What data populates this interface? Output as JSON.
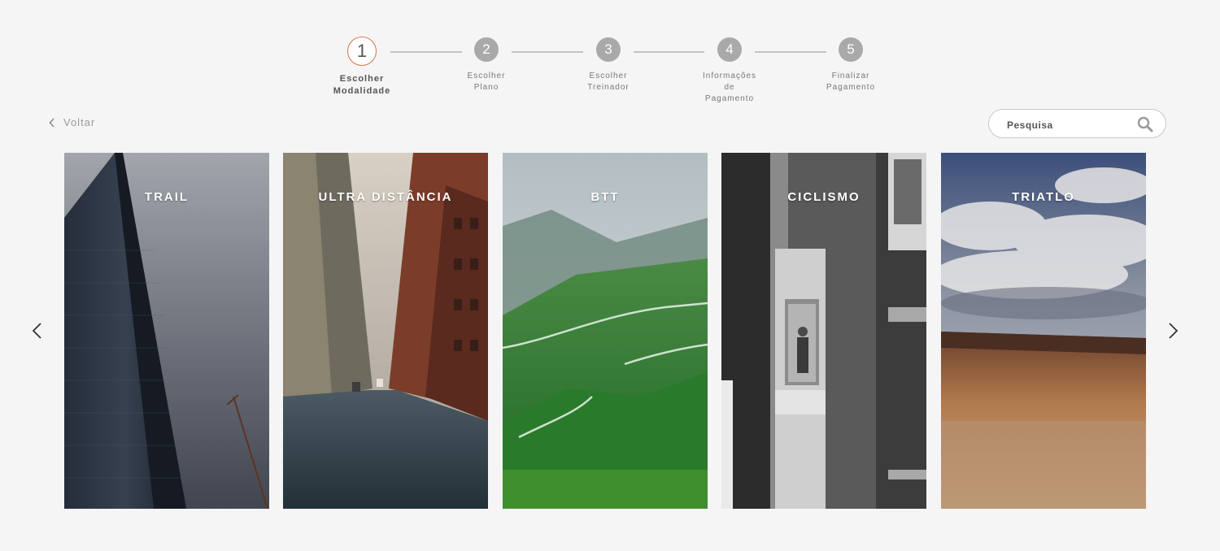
{
  "stepper": {
    "active_index": 0,
    "steps": [
      {
        "number": "1",
        "label_lines": [
          "Escolher",
          "Modalidade"
        ]
      },
      {
        "number": "2",
        "label_lines": [
          "Escolher",
          "Plano"
        ]
      },
      {
        "number": "3",
        "label_lines": [
          "Escolher",
          "Treinador"
        ]
      },
      {
        "number": "4",
        "label_lines": [
          "Informações",
          "de",
          "Pagamento"
        ]
      },
      {
        "number": "5",
        "label_lines": [
          "Finalizar",
          "Pagamento"
        ]
      }
    ],
    "accent_color": "#d9734a",
    "inactive_color": "#a9a9a9"
  },
  "back": {
    "label": "Voltar",
    "icon": "chevron-left-icon"
  },
  "search": {
    "placeholder": "Pesquisa",
    "value": "",
    "icon": "search-icon"
  },
  "carousel": {
    "prev_icon": "chevron-left-icon",
    "next_icon": "chevron-right-icon",
    "cards": [
      {
        "title": "TRAIL"
      },
      {
        "title": "ULTRA DISTÂNCIA"
      },
      {
        "title": "BTT"
      },
      {
        "title": "CICLISMO"
      },
      {
        "title": "TRIATLO"
      }
    ]
  }
}
